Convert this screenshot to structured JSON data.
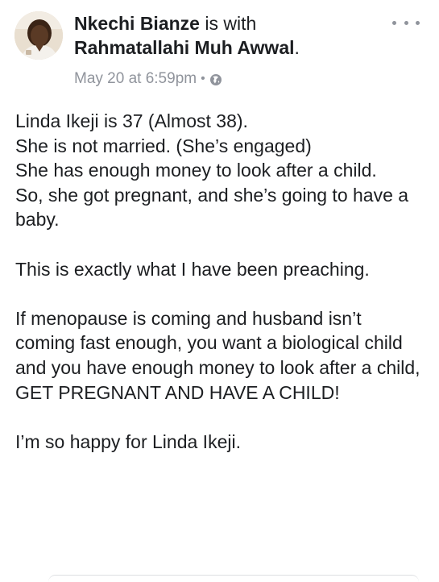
{
  "post": {
    "author": "Nkechi Bianze",
    "with_text": "is with",
    "tagged": "Rahmatallahi Muh Awwal",
    "tagged_suffix": ".",
    "timestamp": "May 20 at 6:59pm",
    "separator": "•",
    "privacy_icon": "globe-icon",
    "more_icon": "ellipsis-icon",
    "paragraphs": [
      [
        "Linda Ikeji is 37 (Almost 38).",
        "She is not married. (She’s engaged)",
        "She has enough money to look after a child.",
        "So, she got pregnant, and she’s going to have a baby."
      ],
      [
        "This is exactly what I have been preaching."
      ],
      [
        "If menopause is coming and husband isn’t coming fast enough, you want a biological child and you have enough money to look after a child, GET PREGNANT AND HAVE A CHILD!"
      ],
      [
        "I’m so happy for Linda Ikeji."
      ]
    ]
  },
  "colors": {
    "text": "#1c1e21",
    "meta": "#90949c"
  }
}
